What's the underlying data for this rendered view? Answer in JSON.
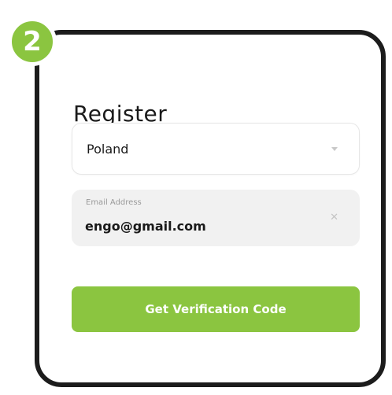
{
  "step": {
    "number": "2",
    "color": "#8bc540"
  },
  "screen": {
    "title": "Register",
    "country": {
      "value": "Poland",
      "icon": "caret-down-icon"
    },
    "email": {
      "label": "Email Address",
      "value": "engo@gmail.com",
      "clear_glyph": "✕",
      "clear_icon": "clear-icon"
    },
    "submit": {
      "label": "Get Verification Code",
      "color": "#8bc540"
    }
  },
  "colors": {
    "accent": "#8bc540",
    "frame": "#1c1c1c",
    "field_bg": "#f1f1f1",
    "text": "#1a1a1a"
  }
}
